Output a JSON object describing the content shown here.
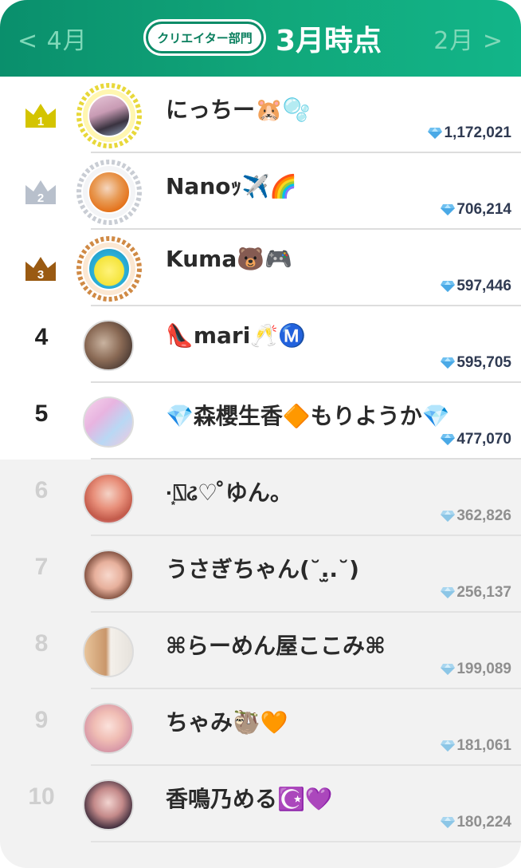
{
  "header": {
    "prev_label": "< 4月",
    "next_label": "2月 >",
    "category_label": "クリエイター部門",
    "title": "3月時点"
  },
  "colors": {
    "header_green": "#0a8f6c",
    "gold": "#d4c400",
    "silver": "#b8c0cc",
    "bronze": "#9a5a12",
    "gem": "#7fc8f0"
  },
  "ranking": [
    {
      "rank": "1",
      "name": "にっちー🐹🫧",
      "score": "1,172,021",
      "badge": "crown-gold-icon"
    },
    {
      "rank": "2",
      "name": "Nanoｯ✈️🌈",
      "score": "706,214",
      "badge": "crown-silver-icon"
    },
    {
      "rank": "3",
      "name": "Kuma🐻🎮",
      "score": "597,446",
      "badge": "crown-bronze-icon"
    },
    {
      "rank": "4",
      "name": "👠mari🥂Ⓜ️",
      "score": "595,705"
    },
    {
      "rank": "5",
      "name": "💎森櫻生香🔶もりようか💎",
      "score": "477,070"
    },
    {
      "rank": "6",
      "name": "·͙⍂ઢ♡ ̊ゆん。",
      "score": "362,826"
    },
    {
      "rank": "7",
      "name": "うさぎちゃん(˘.̫.˘)",
      "score": "256,137"
    },
    {
      "rank": "8",
      "name": "⌘らーめん屋ここみ⌘",
      "score": "199,089"
    },
    {
      "rank": "9",
      "name": "ちゃみ🦥🧡",
      "score": "181,061"
    },
    {
      "rank": "10",
      "name": "香鳴乃める☪️💜",
      "score": "180,224"
    }
  ]
}
